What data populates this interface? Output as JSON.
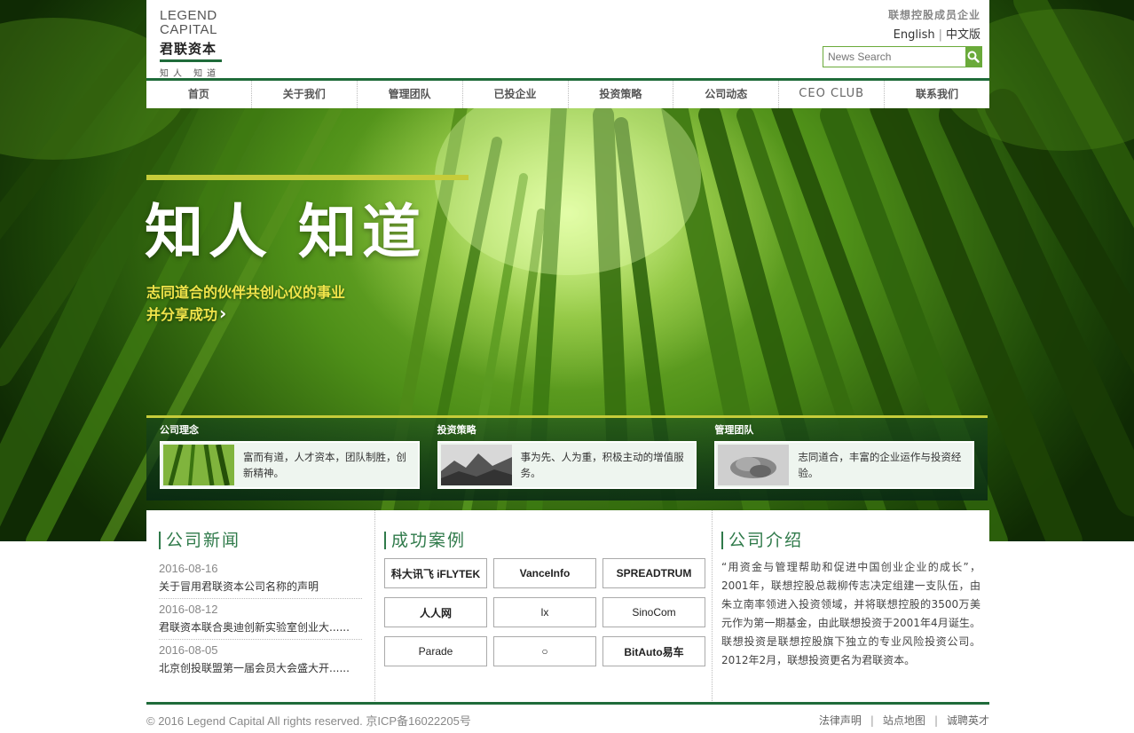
{
  "brand": {
    "logo_en_line1": "LEGEND",
    "logo_en_line2": "CAPITAL",
    "logo_cn": "君联资本",
    "logo_slogan": "知人 知道",
    "accent": "#1f6b3a",
    "highlight": "#c6cc3a"
  },
  "header": {
    "member_title": "联想控股成员企业",
    "lang_en": "English",
    "lang_cn": "中文版",
    "search_placeholder": "News Search",
    "search_icon": "search-icon"
  },
  "nav": {
    "items": [
      {
        "label": "首页"
      },
      {
        "label": "关于我们"
      },
      {
        "label": "管理团队"
      },
      {
        "label": "已投企业"
      },
      {
        "label": "投资策略"
      },
      {
        "label": "公司动态"
      },
      {
        "label": "CEO CLUB"
      },
      {
        "label": "联系我们"
      }
    ]
  },
  "hero": {
    "title": "知人 知道",
    "line1": "志同道合的伙伴共创心仪的事业",
    "line2": "并分享成功",
    "chevron_icon": "chevron-right-icon"
  },
  "features": [
    {
      "title": "公司理念",
      "text": "富而有道，人才资本，团队制胜，创新精神。"
    },
    {
      "title": "投资策略",
      "text": "事为先、人为重，积极主动的增值服务。"
    },
    {
      "title": "管理团队",
      "text": "志同道合，丰富的企业运作与投资经验。"
    }
  ],
  "news": {
    "title": "公司新闻",
    "items": [
      {
        "date": "2016-08-16",
        "title": "关于冒用君联资本公司名称的声明"
      },
      {
        "date": "2016-08-12",
        "title": "君联资本联合奥迪创新实验室创业大......"
      },
      {
        "date": "2016-08-05",
        "title": "北京创投联盟第一届会员大会盛大开......"
      }
    ]
  },
  "cases": {
    "title": "成功案例",
    "logos": [
      {
        "text": "科大讯飞 iFLYTEK"
      },
      {
        "text": "VanceInfo"
      },
      {
        "text": "SPREADTRUM"
      },
      {
        "text": "人人网"
      },
      {
        "text": "lx"
      },
      {
        "text": "SinoCom"
      },
      {
        "text": "Parade"
      },
      {
        "text": "○"
      },
      {
        "text": "BitAuto易车"
      }
    ]
  },
  "about": {
    "title": "公司介绍",
    "text": "“用资金与管理帮助和促进中国创业企业的成长”，2001年，联想控股总裁柳传志决定组建一支队伍，由朱立南率领进入投资领域，并将联想控股的3500万美元作为第一期基金，由此联想投资于2001年4月诞生。联想投资是联想控股旗下独立的专业风险投资公司。2012年2月，联想投资更名为君联资本。"
  },
  "footer": {
    "copyright": "© 2016 Legend Capital All rights reserved. 京ICP备16022205号",
    "links": [
      {
        "label": "法律声明"
      },
      {
        "label": "站点地图"
      },
      {
        "label": "诚聘英才"
      }
    ]
  }
}
